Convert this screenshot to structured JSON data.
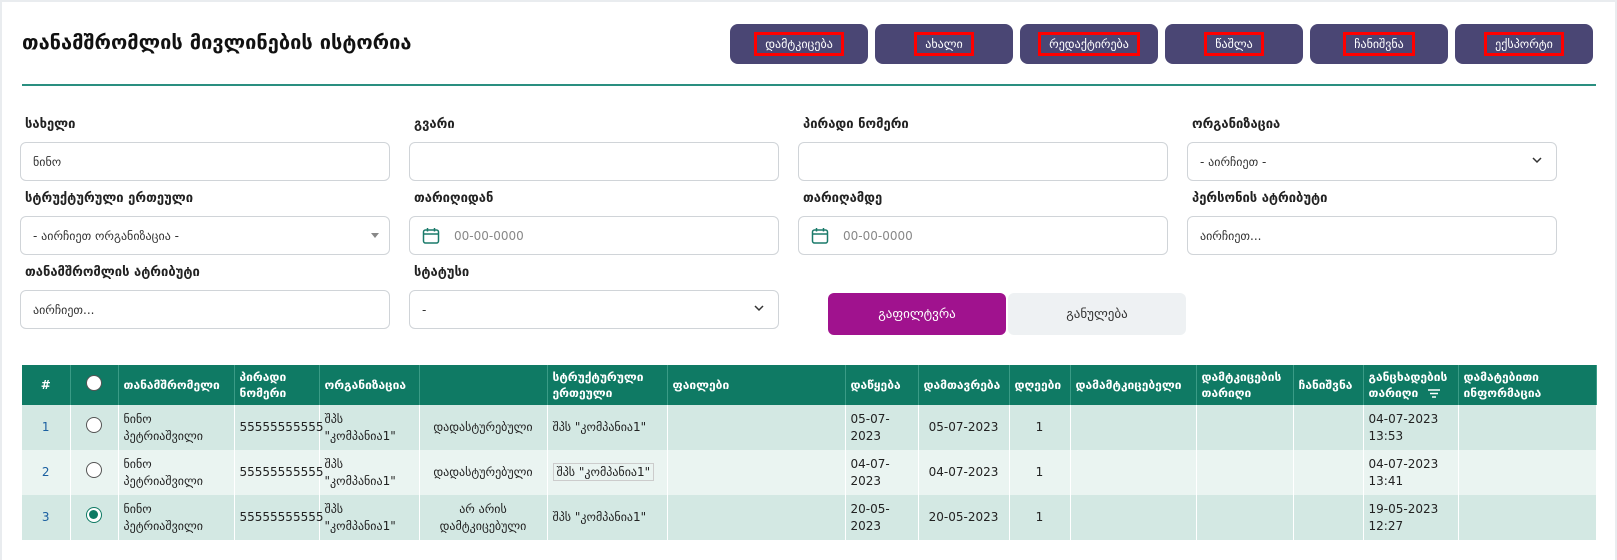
{
  "page": {
    "title": "თანამშრომლის მივლინების ისტორია"
  },
  "toolbar": {
    "approve": "დამტკიცება",
    "new": "ახალი",
    "edit": "რედაქტირება",
    "delete": "წაშლა",
    "note": "ჩანიშვნა",
    "export": "ექსპორტი"
  },
  "filters": {
    "first_name": {
      "label": "სახელი",
      "value": "ნინო"
    },
    "last_name": {
      "label": "გვარი",
      "value": ""
    },
    "personal_number": {
      "label": "პირადი ნომერი",
      "value": ""
    },
    "organization": {
      "label": "ორგანიზაცია",
      "value": "- აირჩიეთ -"
    },
    "structural_unit": {
      "label": "სტრუქტურული ერთეული",
      "value": "- აირჩიეთ ორგანიზაცია -"
    },
    "date_from": {
      "label": "თარიღიდან",
      "placeholder": "00-00-0000"
    },
    "date_to": {
      "label": "თარიღამდე",
      "placeholder": "00-00-0000"
    },
    "personnel_attr": {
      "label": "პერსონის ატრიბუტი",
      "placeholder": "აირჩიეთ..."
    },
    "employee_attr": {
      "label": "თანამშრომლის ატრიბუტი",
      "placeholder": "აირჩიეთ..."
    },
    "status": {
      "label": "სტატუსი",
      "value": "-"
    },
    "filter_button": "გაფილტვრა",
    "reset_button": "განულება"
  },
  "table": {
    "columns": {
      "num": "#",
      "employee": "თანამშრომელი",
      "personal_number": "პირადი ნომერი",
      "organization": "ორგანიზაცია",
      "status": "",
      "structural_unit": "სტრუქტურული ერთეული",
      "files": "ფაილები",
      "start": "დაწყება",
      "end": "დამთავრება",
      "days": "დღეები",
      "approver": "დამამტკიცებელი",
      "approve_date": "დამტკიცების თარიღი",
      "note": "ჩანიშვნა",
      "apply_date": "განცხადების თარიღი",
      "extra_info": "დამატებითი ინფორმაცია"
    },
    "rows": [
      {
        "num": "1",
        "employee": "ნინო პეტრიაშვილი",
        "personal_number": "55555555555",
        "organization": "შპს \"კომპანია1\"",
        "status": "დადასტურებული",
        "structural_unit": "შპს \"კომპანია1\"",
        "files": "",
        "start": "05-07-2023",
        "end": "05-07-2023",
        "days": "1",
        "approver": "",
        "approve_date": "",
        "note": "",
        "apply_date": "04-07-2023 13:53",
        "extra_info": ""
      },
      {
        "num": "2",
        "employee": "ნინო პეტრიაშვილი",
        "personal_number": "55555555555",
        "organization": "შპს \"კომპანია1\"",
        "status": "დადასტურებული",
        "structural_unit": "შპს \"კომპანია1\"",
        "files": "",
        "start": "04-07-2023",
        "end": "04-07-2023",
        "days": "1",
        "approver": "",
        "approve_date": "",
        "note": "",
        "apply_date": "04-07-2023 13:41",
        "extra_info": ""
      },
      {
        "num": "3",
        "employee": "ნინო პეტრიაშვილი",
        "personal_number": "55555555555",
        "organization": "შპს \"კომპანია1\"",
        "status": "არ არის დამტკიცებული",
        "structural_unit": "შპს \"კომპანია1\"",
        "files": "",
        "start": "20-05-2023",
        "end": "20-05-2023",
        "days": "1",
        "approver": "",
        "approve_date": "",
        "note": "",
        "apply_date": "19-05-2023 12:27",
        "extra_info": ""
      }
    ]
  },
  "colors": {
    "accent": "#0f7a64",
    "toolbar": "#4a4674",
    "filter": "#a0128e"
  }
}
